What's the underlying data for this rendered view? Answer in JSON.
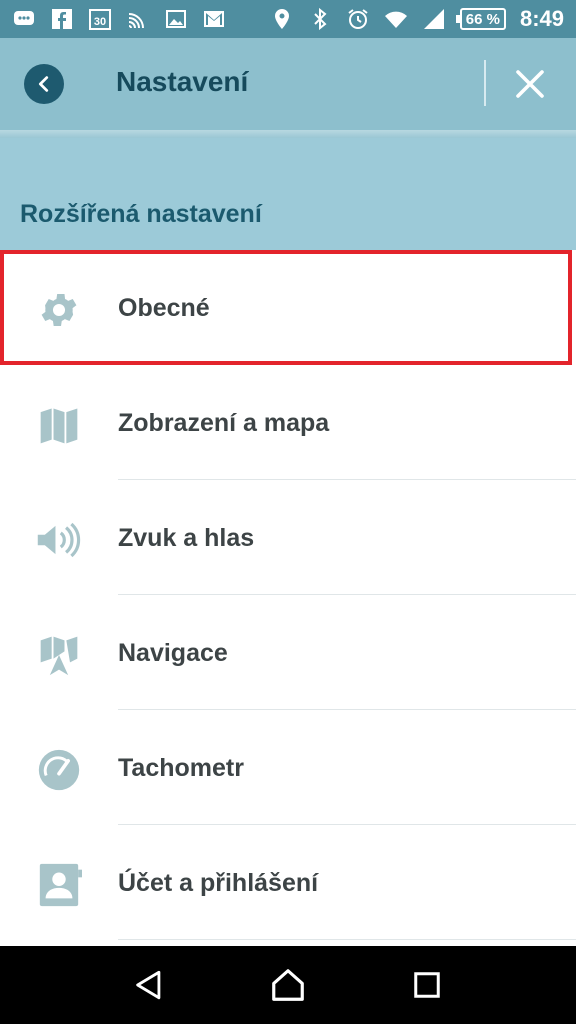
{
  "status_bar": {
    "calendar_day": "30",
    "battery": "66 %",
    "time": "8:49",
    "left_icons": [
      "chat-icon",
      "facebook-icon",
      "calendar-icon",
      "cast-icon",
      "image-icon",
      "gmail-icon"
    ],
    "right_icons": [
      "location-icon",
      "bluetooth-icon",
      "alarm-icon",
      "wifi-icon",
      "signal-icon",
      "battery-icon"
    ]
  },
  "header": {
    "title": "Nastavení"
  },
  "section": {
    "title": "Rozšířená nastavení"
  },
  "menu": {
    "items": [
      {
        "label": "Obecné",
        "icon": "gear-icon",
        "selected": true
      },
      {
        "label": "Zobrazení a mapa",
        "icon": "map-icon"
      },
      {
        "label": "Zvuk a hlas",
        "icon": "speaker-icon"
      },
      {
        "label": "Navigace",
        "icon": "navigation-icon"
      },
      {
        "label": "Tachometr",
        "icon": "speedometer-icon"
      },
      {
        "label": "Účet a přihlášení",
        "icon": "account-icon"
      }
    ]
  },
  "colors": {
    "status_bar": "#4f8ea0",
    "app_bar": "#8dbfcd",
    "section": "#9ccad8",
    "title_text": "#164a5c",
    "icon": "#a8c4c9",
    "selection_border": "#e3242b"
  }
}
